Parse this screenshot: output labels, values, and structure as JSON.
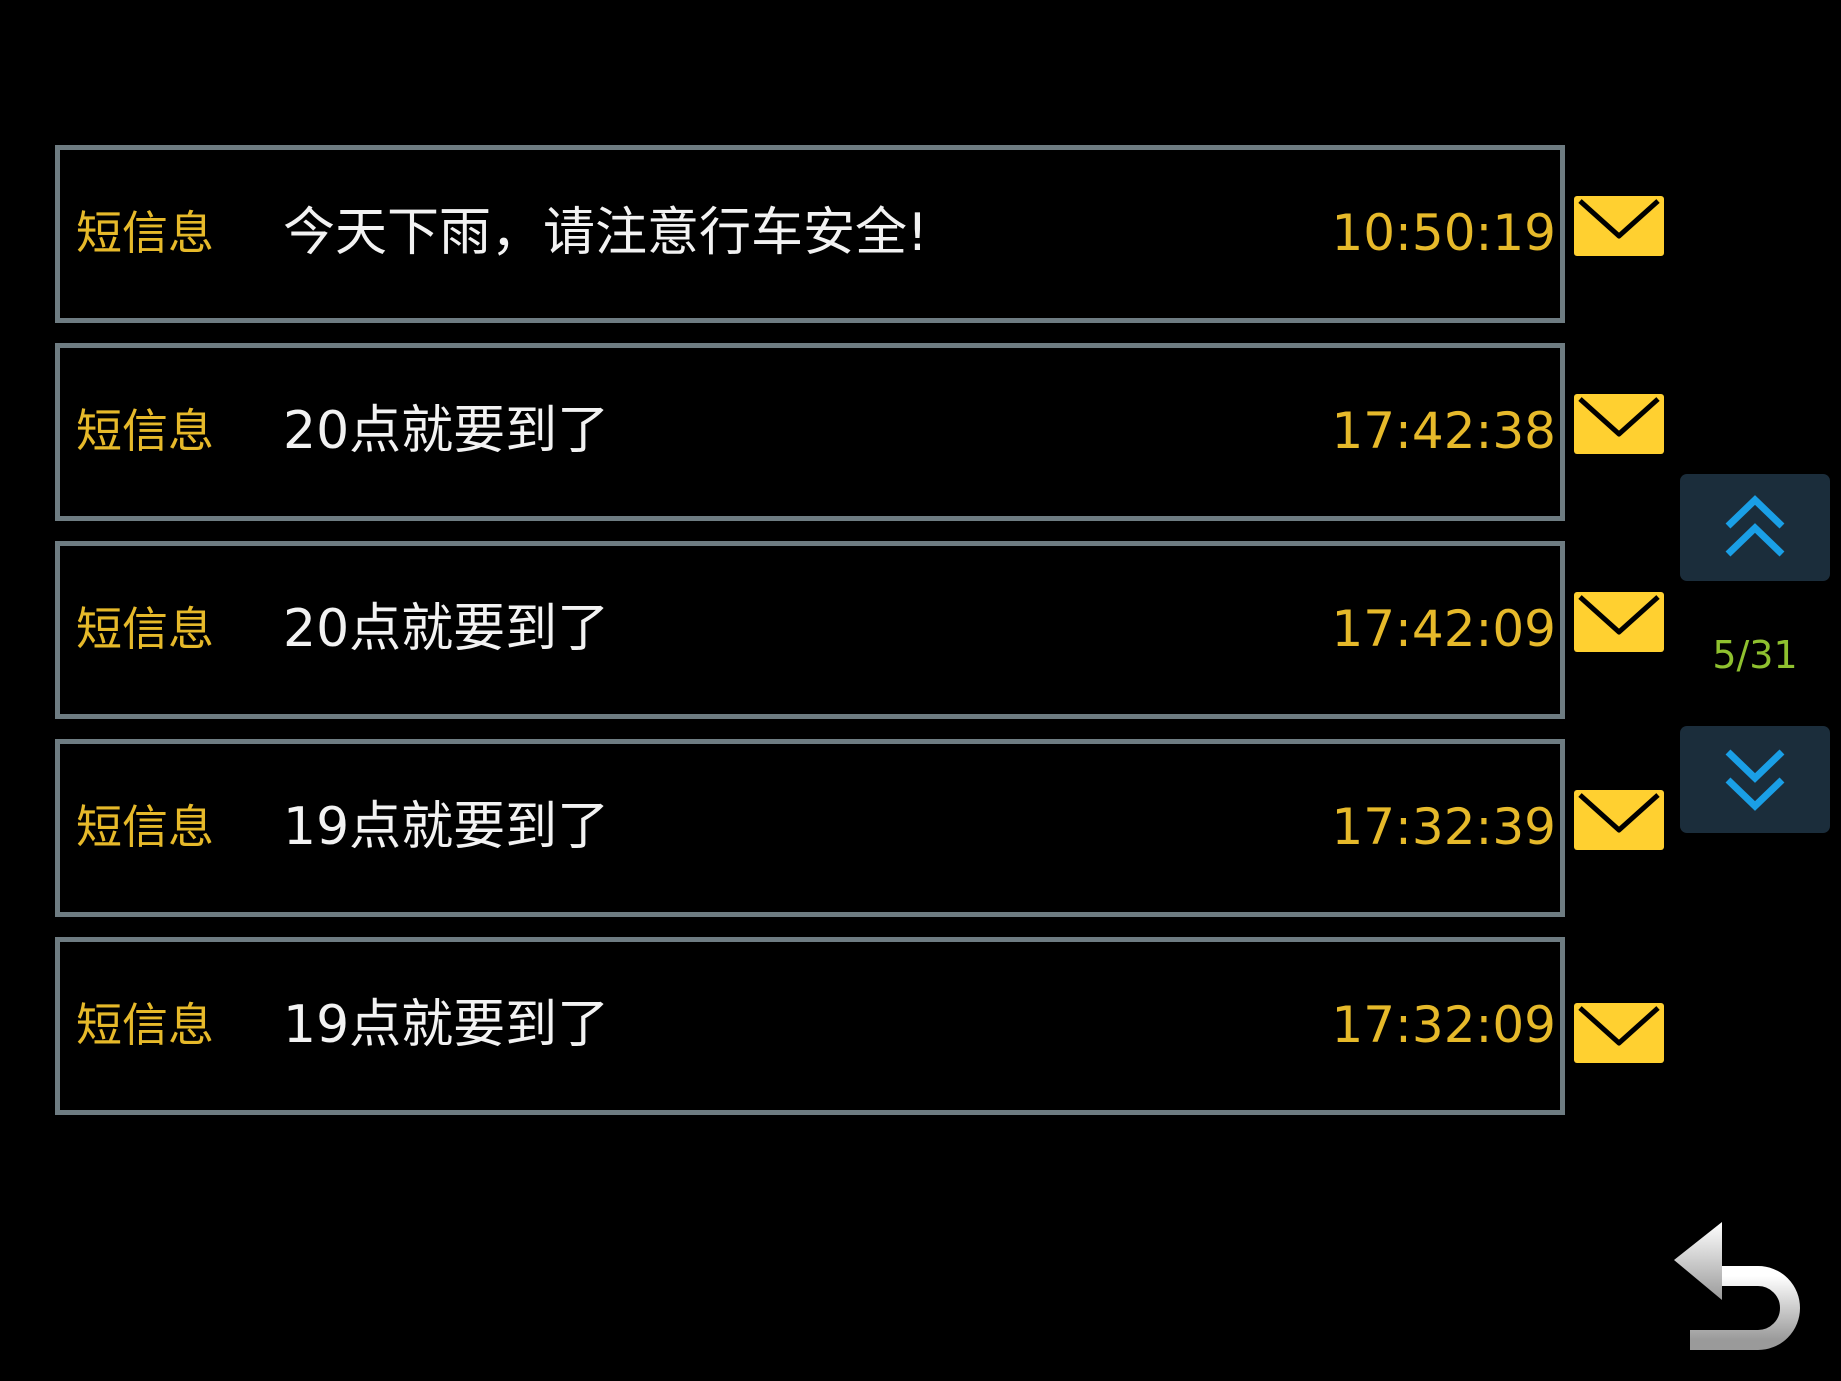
{
  "messages": [
    {
      "type": "短信息",
      "text": "今天下雨，请注意行车安全!",
      "time": "10:50:19",
      "icon": "envelope-icon"
    },
    {
      "type": "短信息",
      "text": "20点就要到了",
      "time": "17:42:38",
      "icon": "envelope-icon"
    },
    {
      "type": "短信息",
      "text": "20点就要到了",
      "time": "17:42:09",
      "icon": "envelope-icon"
    },
    {
      "type": "短信息",
      "text": "19点就要到了",
      "time": "17:32:39",
      "icon": "envelope-icon"
    },
    {
      "type": "短信息",
      "text": "19点就要到了",
      "time": "17:32:09",
      "icon": "envelope-icon"
    }
  ],
  "pagination": {
    "indicator": "5/31",
    "page_up_icon": "double-chevron-up-icon",
    "page_down_icon": "double-chevron-down-icon"
  },
  "back_button": {
    "icon": "back-arrow-icon"
  },
  "colors": {
    "background": "#000000",
    "row_border": "#6e7c82",
    "type_label": "#e6b92a",
    "message_text": "#f2f2f2",
    "time": "#e6b92a",
    "envelope": "#ffd030",
    "page_button_bg": "#1b2d3b",
    "page_button_arrow": "#1a9fe6",
    "indicator": "#8fc12f"
  }
}
